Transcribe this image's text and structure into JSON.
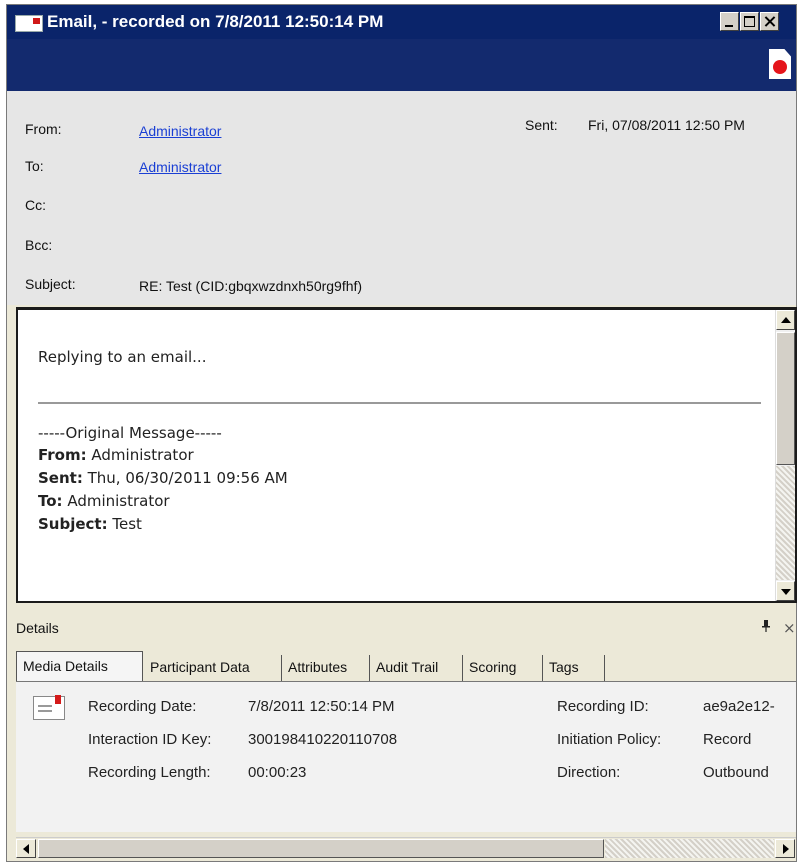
{
  "window": {
    "title": "Email, - recorded on 7/8/2011 12:50:14 PM",
    "accent": "#0a246a",
    "header_bar_color": "#132a6e",
    "record_color": "#e5141b"
  },
  "email": {
    "from_label": "From:",
    "from_value": "Administrator",
    "to_label": "To:",
    "to_value": "Administrator",
    "cc_label": "Cc:",
    "bcc_label": "Bcc:",
    "subject_label": "Subject:",
    "subject_value": "RE: Test (CID:gbqxwzdnxh50rg9fhf)",
    "sent_label": "Sent:",
    "sent_value": "Fri, 07/08/2011 12:50 PM"
  },
  "message": {
    "reply_text": "Replying to an email...",
    "original_header": "-----Original Message-----",
    "from_label": "From:",
    "from_value": "Administrator",
    "sent_label": "Sent:",
    "sent_value": "Thu, 06/30/2011 09:56 AM",
    "to_label": "To:",
    "to_value": "Administrator",
    "subject_label": "Subject:",
    "subject_value": "Test"
  },
  "details": {
    "title": "Details",
    "pin_icon": "pin-icon",
    "close_glyph": "×",
    "tabs": [
      {
        "label": "Media Details"
      },
      {
        "label": "Participant Data"
      },
      {
        "label": "Attributes"
      },
      {
        "label": "Audit Trail"
      },
      {
        "label": "Scoring"
      },
      {
        "label": "Tags"
      }
    ],
    "recording_date_label": "Recording Date:",
    "recording_date_value": "7/8/2011 12:50:14 PM",
    "interaction_id_label": "Interaction ID Key:",
    "interaction_id_value": "300198410220110708",
    "recording_length_label": "Recording Length:",
    "recording_length_value": "00:00:23",
    "recording_id_label": "Recording ID:",
    "recording_id_value": "ae9a2e12-",
    "initiation_policy_label": "Initiation Policy:",
    "initiation_policy_value": "Record",
    "direction_label": "Direction:",
    "direction_value": "Outbound"
  }
}
